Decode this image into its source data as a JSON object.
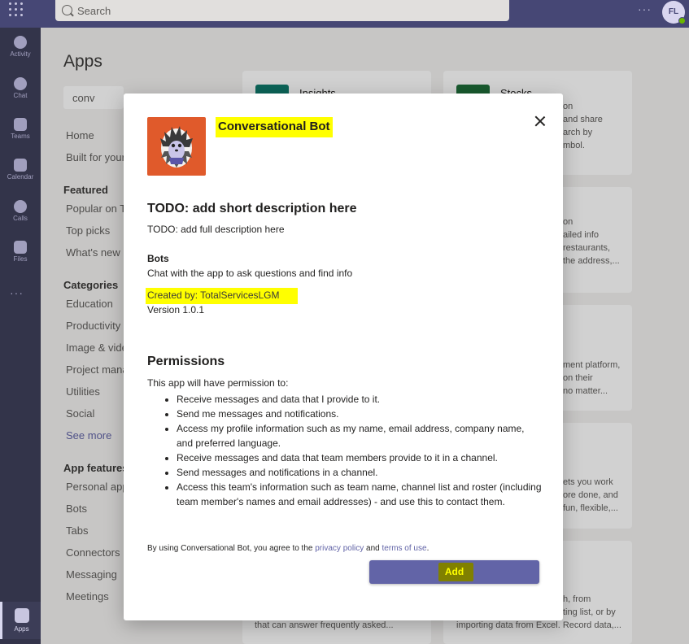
{
  "topbar": {
    "search_placeholder": "Search",
    "more": "···",
    "avatar_initials": "FL"
  },
  "rail": {
    "items": [
      "Activity",
      "Chat",
      "Teams",
      "Calendar",
      "Calls",
      "Files"
    ],
    "more": "···",
    "apps_label": "Apps"
  },
  "apps_panel": {
    "title": "Apps",
    "filter_value": "conv",
    "nav": {
      "home": "Home",
      "built_for": "Built for your",
      "featured_header": "Featured",
      "popular": "Popular on Te",
      "top_picks": "Top picks",
      "whats_new": "What's new",
      "categories_header": "Categories",
      "education": "Education",
      "productivity": "Productivity",
      "image_video": "Image & vide",
      "project_mgmt": "Project mana",
      "utilities": "Utilities",
      "social": "Social",
      "see_more": "See more",
      "features_header": "App features",
      "personal_apps": "Personal app",
      "bots": "Bots",
      "tabs": "Tabs",
      "connectors": "Connectors",
      "messaging": "Messaging",
      "meetings": "Meetings"
    }
  },
  "cards": {
    "insights_name": "Insights",
    "stocks_name": "Stocks",
    "stocks_frag": [
      "on",
      "and share",
      "arch by",
      "mbol."
    ],
    "c2_frag": [
      "on",
      "ailed info",
      "restaurants,",
      "the address,..."
    ],
    "c3_frag": [
      "ment platform,",
      "on their",
      "no matter..."
    ],
    "c4_frag": [
      "ets you work",
      "ore done, and",
      "fun, flexible,..."
    ],
    "c5_frag": [
      "h, from",
      "ting list, or by"
    ],
    "bottom_left": "that can answer frequently asked...",
    "bottom_right": "importing data from Excel. Record data,..."
  },
  "dialog": {
    "app_name": "Conversational Bot",
    "short_description": "TODO: add short description here",
    "full_description": "TODO: add full description here",
    "bots_heading": "Bots",
    "bots_description": "Chat with the app to ask questions and find info",
    "created_by": "Created by: TotalServicesLGM",
    "version": "Version 1.0.1",
    "permissions_heading": "Permissions",
    "permissions_intro": "This app will have permission to:",
    "permissions": [
      "Receive messages and data that I provide to it.",
      "Send me messages and notifications.",
      "Access my profile information such as my name, email address, company name, and preferred language.",
      "Receive messages and data that team members provide to it in a channel.",
      "Send messages and notifications in a channel.",
      "Access this team's information such as team name, channel list and roster (including team member's names and email addresses) - and use this to contact them."
    ],
    "agree_prefix": "By using Conversational Bot, you agree to the ",
    "privacy_policy": "privacy policy",
    "agree_and": " and ",
    "terms_of_use": "terms of use",
    "agree_suffix": ".",
    "add_label": "Add"
  },
  "colors": {
    "accent": "#6264a7",
    "highlight": "#ffff00",
    "app_icon_bg": "#e05a2b",
    "rail": "#33344a",
    "topbar": "#464775"
  }
}
